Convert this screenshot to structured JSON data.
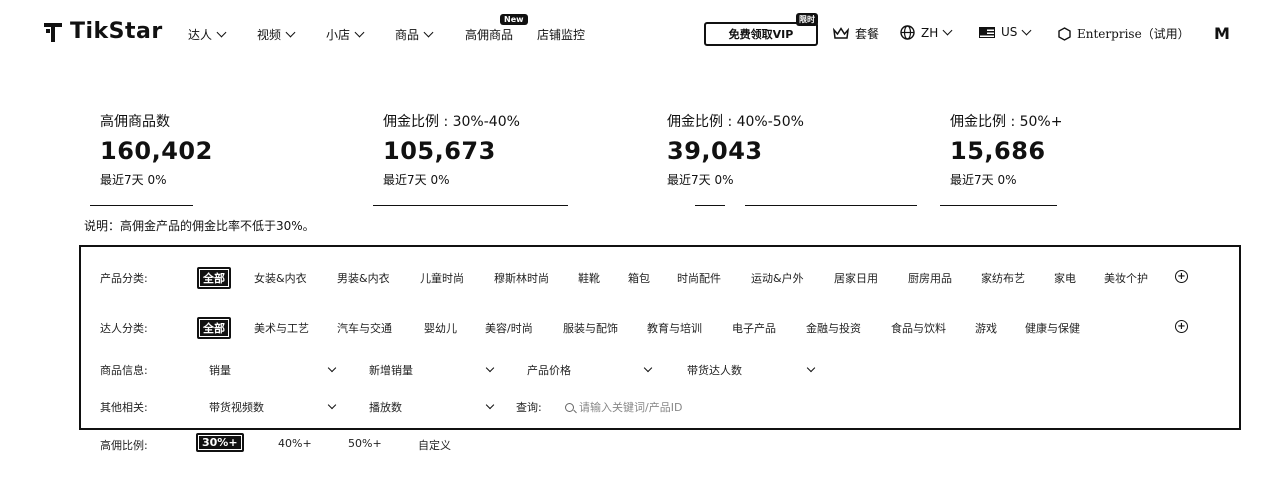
{
  "nav": {
    "brand": "TikStar",
    "items": [
      {
        "label": "达人",
        "dropdown": true
      },
      {
        "label": "视频",
        "dropdown": true
      },
      {
        "label": "小店",
        "dropdown": true
      },
      {
        "label": "商品",
        "dropdown": true
      },
      {
        "label": "高佣商品",
        "dropdown": false
      },
      {
        "label": "店铺监控",
        "dropdown": false
      }
    ],
    "new_badge": "New",
    "vip_button": "免费领取VIP",
    "vip_badge": "限时",
    "plan": "套餐",
    "language": "ZH",
    "region": "US",
    "enterprise": "Enterprise（试用）",
    "avatar": "M"
  },
  "stats": [
    {
      "label": "高佣商品数",
      "value": "160,402",
      "sub": "最近7天 0%"
    },
    {
      "label": "佣金比例 : 30%-40%",
      "value": "105,673",
      "sub": "最近7天 0%"
    },
    {
      "label": "佣金比例 : 40%-50%",
      "value": "39,043",
      "sub": "最近7天 0%"
    },
    {
      "label": "佣金比例 : 50%+",
      "value": "15,686",
      "sub": "最近7天 0%"
    }
  ],
  "note": "说明：高佣金产品的佣金比率不低于30%。",
  "filters": {
    "product_category": {
      "label": "产品分类:",
      "options": [
        "全部",
        "女装&内衣",
        "男装&内衣",
        "儿童时尚",
        "穆斯林时尚",
        "鞋靴",
        "箱包",
        "时尚配件",
        "运动&户外",
        "居家日用",
        "厨房用品",
        "家纺布艺",
        "家电",
        "美妆个护"
      ]
    },
    "creator_category": {
      "label": "达人分类:",
      "options": [
        "全部",
        "美术与工艺",
        "汽车与交通",
        "婴幼儿",
        "美容/时尚",
        "服装与配饰",
        "教育与培训",
        "电子产品",
        "金融与投资",
        "食品与饮料",
        "游戏",
        "健康与保健"
      ]
    },
    "product_info": {
      "label": "商品信息:",
      "selects": [
        "销量",
        "新增销量",
        "产品价格",
        "带货达人数"
      ]
    },
    "other": {
      "label": "其他相关:",
      "selects": [
        "带货视频数",
        "播放数"
      ],
      "search_label": "查询:",
      "search_placeholder": "请输入关键词/产品ID"
    },
    "ratio": {
      "label": "高佣比例:",
      "options": [
        "30%+",
        "40%+",
        "50%+",
        "自定义"
      ]
    }
  }
}
